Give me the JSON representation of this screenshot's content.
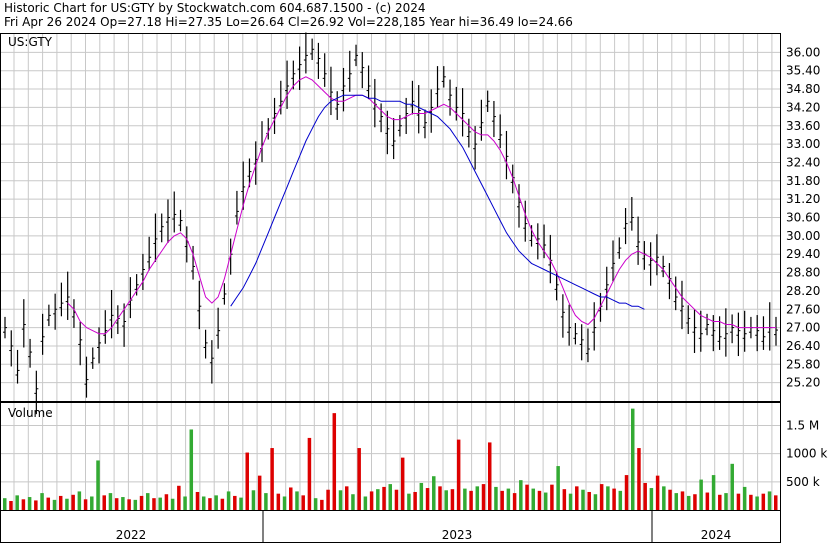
{
  "header": {
    "line1": "Historic Chart for US:GTY by Stockwatch.com 604.687.1500 - (c) 2024",
    "line2": "Fri Apr 26 2024   Op=27.18   Hi=27.35   Lo=26.64   Cl=26.92   Vol=228,185   Year hi=36.49   lo=24.66"
  },
  "colors": {
    "price_bar": "#000000",
    "ma_short": "#cc00cc",
    "ma_long": "#0000cc",
    "vol_up": "#33aa33",
    "vol_down": "#dd0000",
    "grid": "#c8c8c8"
  },
  "chart_data": [
    {
      "type": "line",
      "panel": "price",
      "label": "US:GTY",
      "y_ticks": [
        "36.00",
        "35.40",
        "34.80",
        "34.20",
        "33.60",
        "33.00",
        "32.40",
        "31.80",
        "31.20",
        "30.60",
        "30.00",
        "29.40",
        "28.80",
        "28.20",
        "27.60",
        "27.00",
        "26.40",
        "25.80",
        "25.20"
      ],
      "ylim": [
        24.6,
        36.6
      ],
      "x_labels": [
        "2022",
        "2023",
        "2024"
      ],
      "grid": true,
      "series": [
        {
          "key": "price",
          "values": [
            27.0,
            26.4,
            25.6,
            27.1,
            26.2,
            25.0,
            26.7,
            27.4,
            27.6,
            27.8,
            28.0,
            27.5,
            26.6,
            25.3,
            26.0,
            26.5,
            26.9,
            27.4,
            27.3,
            27.2,
            27.9,
            28.4,
            28.9,
            29.3,
            29.9,
            30.3,
            30.6,
            30.7,
            30.5,
            29.8,
            29.0,
            27.7,
            26.5,
            26.0,
            26.9,
            28.1,
            29.4,
            30.8,
            31.6,
            32.1,
            32.5,
            33.0,
            33.5,
            34.0,
            34.4,
            34.9,
            35.3,
            35.6,
            35.9,
            36.1,
            35.8,
            35.3,
            34.7,
            34.3,
            34.9,
            35.3,
            35.9,
            35.5,
            34.9,
            34.3,
            33.9,
            33.5,
            33.1,
            33.6,
            34.0,
            34.4,
            34.1,
            33.7,
            34.2,
            34.8,
            35.2,
            34.6,
            34.2,
            34.0,
            33.4,
            33.0,
            33.7,
            34.4,
            33.9,
            33.3,
            32.6,
            31.9,
            31.1,
            30.4,
            30.0,
            29.9,
            29.7,
            29.2,
            28.4,
            27.5,
            27.0,
            26.8,
            26.6,
            26.3,
            27.0,
            27.7,
            28.4,
            29.1,
            29.6,
            30.4,
            30.6,
            29.8,
            29.4,
            29.2,
            29.3,
            29.0,
            28.6,
            28.0,
            27.7,
            27.3,
            27.0,
            26.8,
            27.1,
            26.9,
            26.7,
            26.8,
            27.0,
            26.9,
            26.8,
            27.0,
            26.9,
            26.7,
            27.0,
            26.92
          ],
          "color": "#000000"
        },
        {
          "key": "ma_short",
          "values": [
            null,
            null,
            null,
            null,
            null,
            null,
            null,
            null,
            null,
            null,
            27.8,
            27.6,
            27.2,
            27.0,
            26.9,
            26.8,
            26.8,
            27.0,
            27.3,
            27.6,
            27.9,
            28.2,
            28.5,
            28.9,
            29.2,
            29.5,
            29.8,
            30.0,
            30.1,
            29.9,
            29.4,
            28.7,
            28.0,
            27.8,
            28.0,
            28.6,
            29.4,
            30.2,
            31.0,
            31.7,
            32.3,
            32.9,
            33.4,
            33.8,
            34.2,
            34.6,
            34.9,
            35.1,
            35.2,
            35.1,
            34.9,
            34.7,
            34.5,
            34.4,
            34.4,
            34.5,
            34.6,
            34.6,
            34.5,
            34.3,
            34.1,
            33.9,
            33.8,
            33.8,
            33.9,
            34.0,
            34.0,
            34.0,
            34.1,
            34.2,
            34.3,
            34.2,
            34.0,
            33.8,
            33.6,
            33.4,
            33.3,
            33.3,
            33.1,
            32.8,
            32.4,
            31.9,
            31.3,
            30.7,
            30.2,
            29.8,
            29.5,
            29.2,
            28.8,
            28.3,
            27.8,
            27.4,
            27.2,
            27.1,
            27.3,
            27.7,
            28.1,
            28.5,
            28.9,
            29.2,
            29.4,
            29.5,
            29.4,
            29.3,
            29.1,
            28.9,
            28.6,
            28.3,
            28.0,
            27.8,
            27.6,
            27.4,
            27.3,
            27.2,
            27.2,
            27.1,
            27.1,
            27.0,
            27.0,
            27.0,
            27.0,
            27.0,
            27.0,
            27.0
          ],
          "color": "#cc00cc"
        },
        {
          "key": "ma_long",
          "values": [
            null,
            null,
            null,
            null,
            null,
            null,
            null,
            null,
            null,
            null,
            null,
            null,
            null,
            null,
            null,
            null,
            null,
            null,
            null,
            null,
            null,
            null,
            null,
            null,
            null,
            null,
            null,
            null,
            null,
            null,
            null,
            null,
            null,
            null,
            null,
            null,
            27.7,
            28.0,
            28.3,
            28.7,
            29.1,
            29.6,
            30.1,
            30.6,
            31.1,
            31.6,
            32.1,
            32.6,
            33.1,
            33.5,
            33.9,
            34.2,
            34.4,
            34.5,
            34.6,
            34.6,
            34.6,
            34.6,
            34.5,
            34.5,
            34.4,
            34.4,
            34.4,
            34.4,
            34.3,
            34.3,
            34.2,
            34.1,
            34.0,
            33.9,
            33.7,
            33.5,
            33.2,
            32.9,
            32.5,
            32.1,
            31.7,
            31.3,
            30.9,
            30.5,
            30.1,
            29.8,
            29.5,
            29.3,
            29.1,
            29.0,
            28.9,
            28.8,
            28.7,
            28.6,
            28.5,
            28.4,
            28.3,
            28.2,
            28.1,
            28.0,
            28.0,
            27.9,
            27.8,
            27.8,
            27.7,
            27.7,
            27.6
          ],
          "color": "#0000cc"
        }
      ]
    },
    {
      "type": "bar",
      "panel": "volume",
      "title": "Volume",
      "y_ticks": [
        "1.5 M",
        "1000 k",
        "500 k"
      ],
      "ylim": [
        0,
        1900
      ],
      "unit": "k",
      "x_labels": [
        "2022",
        "2023",
        "2024"
      ],
      "values": [
        210,
        160,
        260,
        190,
        230,
        170,
        300,
        220,
        180,
        250,
        200,
        270,
        330,
        190,
        240,
        880,
        260,
        300,
        210,
        230,
        190,
        180,
        250,
        300,
        210,
        220,
        280,
        200,
        430,
        240,
        1430,
        320,
        240,
        210,
        260,
        200,
        330,
        250,
        220,
        1020,
        350,
        610,
        300,
        1100,
        290,
        240,
        400,
        330,
        260,
        1280,
        210,
        180,
        360,
        1720,
        350,
        420,
        280,
        1100,
        240,
        330,
        370,
        410,
        460,
        360,
        930,
        290,
        320,
        480,
        390,
        600,
        420,
        350,
        370,
        1250,
        380,
        340,
        420,
        460,
        1200,
        410,
        340,
        380,
        300,
        530,
        450,
        380,
        340,
        310,
        450,
        780,
        370,
        290,
        420,
        360,
        320,
        280,
        460,
        420,
        380,
        340,
        620,
        1800,
        1100,
        480,
        390,
        610,
        420,
        360,
        300,
        330,
        250,
        280,
        540,
        310,
        620,
        270,
        300,
        820,
        290,
        410,
        270,
        240,
        290,
        330,
        260
      ],
      "colors": [
        "up",
        "down",
        "up",
        "down",
        "up",
        "down",
        "up",
        "down",
        "up",
        "down",
        "up",
        "down",
        "up",
        "down",
        "up",
        "up",
        "down",
        "up",
        "down",
        "up",
        "down",
        "up",
        "down",
        "up",
        "down",
        "up",
        "down",
        "up",
        "down",
        "up",
        "up",
        "down",
        "up",
        "down",
        "up",
        "down",
        "up",
        "down",
        "up",
        "down",
        "up",
        "down",
        "up",
        "down",
        "down",
        "up",
        "down",
        "up",
        "down",
        "down",
        "up",
        "down",
        "down",
        "down",
        "up",
        "down",
        "up",
        "down",
        "up",
        "down",
        "up",
        "down",
        "up",
        "down",
        "down",
        "up",
        "down",
        "up",
        "down",
        "up",
        "down",
        "up",
        "down",
        "down",
        "up",
        "down",
        "up",
        "down",
        "down",
        "up",
        "down",
        "up",
        "down",
        "up",
        "down",
        "up",
        "down",
        "up",
        "down",
        "up",
        "down",
        "up",
        "down",
        "up",
        "down",
        "up",
        "down",
        "up",
        "down",
        "up",
        "down",
        "up",
        "down",
        "down",
        "up",
        "down",
        "up",
        "down",
        "up",
        "down",
        "up",
        "down",
        "up",
        "down",
        "up",
        "down",
        "up",
        "up",
        "down",
        "up",
        "down",
        "up",
        "down",
        "up",
        "down",
        "up"
      ]
    }
  ]
}
